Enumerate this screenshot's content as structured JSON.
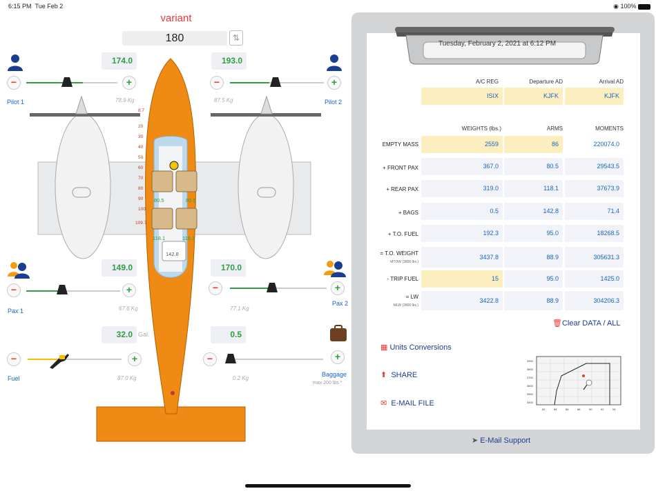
{
  "status": {
    "time": "6:15 PM",
    "date": "Tue Feb 2",
    "battery": "100%"
  },
  "variant": {
    "title": "variant",
    "value": "180"
  },
  "pilot1": {
    "value": "174.0",
    "sub": "78.9 Kg",
    "label": "Pilot 1",
    "level": 0.62
  },
  "pilot2": {
    "value": "193.0",
    "sub": "87.5 Kg",
    "label": "Pilot 2",
    "level": 0.42
  },
  "pax1": {
    "value": "149.0",
    "sub": "67.6 Kg",
    "label": "Pax 1",
    "level": 0.42
  },
  "pax2": {
    "value": "170.0",
    "sub": "77.1 Kg",
    "label": "Pax 2",
    "level": 0.45
  },
  "fuel": {
    "value": "32.0",
    "unit": "Gal.",
    "sub": "87.0 Kg",
    "label": "Fuel",
    "level": 0.4
  },
  "baggage": {
    "value": "0.5",
    "sub": "0.2 Kg",
    "label": "Baggage",
    "max": "max 200 lbs *",
    "level": 0.0
  },
  "plane": {
    "arm_ticks": [
      "8.7",
      "20",
      "30",
      "40",
      "50",
      "60",
      "70",
      "80",
      "90",
      "100",
      "109.7"
    ],
    "seat_front_l": "80.5",
    "seat_front_r": "80.5",
    "seat_rear_l": "118.1",
    "seat_rear_r": "118.1",
    "bag_arm": "142.8"
  },
  "sheet": {
    "date": "Tuesday, February 2, 2021 at 6:12 PM",
    "reg_headers": [
      "A/C REG",
      "Departure AD",
      "Arrival AD"
    ],
    "reg_values": [
      "ISIX",
      "KJFK",
      "KJFK"
    ],
    "col_headers": [
      "WEIGHTS (lbs.)",
      "ARMS",
      "MOMENTS"
    ],
    "rows": [
      {
        "label": "EMPTY MASS",
        "sub": "",
        "weight": "2559",
        "arm": "86",
        "moment": "220074.0"
      },
      {
        "label": "+ FRONT PAX",
        "sub": "",
        "weight": "367.0",
        "arm": "80.5",
        "moment": "29543.5"
      },
      {
        "label": "+ REAR PAX",
        "sub": "",
        "weight": "319.0",
        "arm": "118.1",
        "moment": "37673.9"
      },
      {
        "label": "+ BAGS",
        "sub": "",
        "weight": "0.5",
        "arm": "142.8",
        "moment": "71.4"
      },
      {
        "label": "+ T.O. FUEL",
        "sub": "",
        "weight": "192.3",
        "arm": "95.0",
        "moment": "18268.5"
      },
      {
        "label": "= T.O. WEIGHT",
        "sub": "MTOW (3800 lbs.)",
        "weight": "3437.8",
        "arm": "88.9",
        "moment": "305631.3"
      },
      {
        "label": "- TRIP FUEL",
        "sub": "",
        "weight": "15",
        "arm": "95.0",
        "moment": "1425.0"
      },
      {
        "label": "= LW",
        "sub": "MLW (3800 lbs.)",
        "weight": "3422.8",
        "arm": "88.9",
        "moment": "304206.3"
      }
    ],
    "clear": "Clear DATA / ALL",
    "units": "Units Conversions",
    "share": "SHARE",
    "email": "E-MAIL FILE",
    "support": "E-Mail Support",
    "envelope_y": [
      "3900",
      "3800",
      "3700",
      "3600",
      "3500",
      "3400"
    ],
    "envelope_x": [
      "82",
      "84",
      "86",
      "88",
      "90",
      "92",
      "94"
    ]
  }
}
